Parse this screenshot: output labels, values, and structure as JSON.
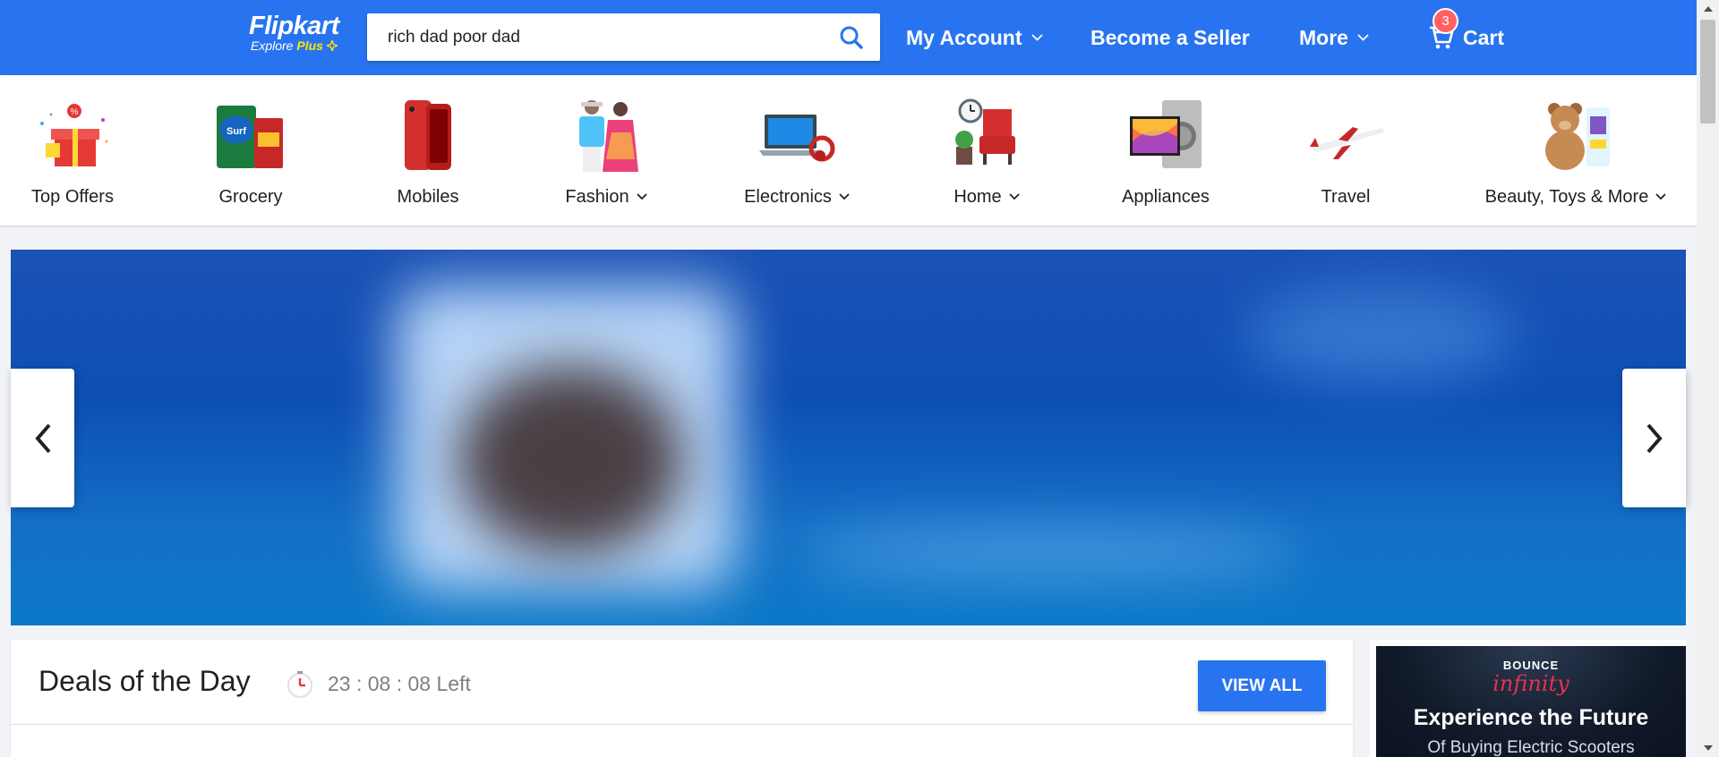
{
  "header": {
    "logo_main": "Flipkart",
    "logo_sub_prefix": "Explore",
    "logo_sub_plus": "Plus",
    "search_value": "rich dad poor dad",
    "nav": {
      "account": "My Account",
      "seller": "Become a Seller",
      "more": "More",
      "cart": "Cart",
      "cart_count": "3"
    }
  },
  "categories": [
    {
      "label": "Top Offers",
      "has_dropdown": false,
      "icon": "gift-icon"
    },
    {
      "label": "Grocery",
      "has_dropdown": false,
      "icon": "grocery-icon"
    },
    {
      "label": "Mobiles",
      "has_dropdown": false,
      "icon": "mobile-icon"
    },
    {
      "label": "Fashion",
      "has_dropdown": true,
      "icon": "fashion-icon"
    },
    {
      "label": "Electronics",
      "has_dropdown": true,
      "icon": "laptop-icon"
    },
    {
      "label": "Home",
      "has_dropdown": true,
      "icon": "armchair-icon"
    },
    {
      "label": "Appliances",
      "has_dropdown": false,
      "icon": "appliance-icon"
    },
    {
      "label": "Travel",
      "has_dropdown": false,
      "icon": "airplane-icon"
    },
    {
      "label": "Beauty, Toys & More",
      "has_dropdown": true,
      "icon": "teddy-icon"
    }
  ],
  "deals": {
    "title": "Deals of the Day",
    "timer": "23 : 08 : 08 Left",
    "view_all": "VIEW ALL"
  },
  "ad": {
    "brand": "BOUNCE",
    "logo": "infinity",
    "headline": "Experience the Future",
    "subline": "Of Buying Electric Scooters"
  },
  "colors": {
    "primary": "#2874f0",
    "badge": "#ff6161",
    "logo_plus": "#ffe500"
  }
}
